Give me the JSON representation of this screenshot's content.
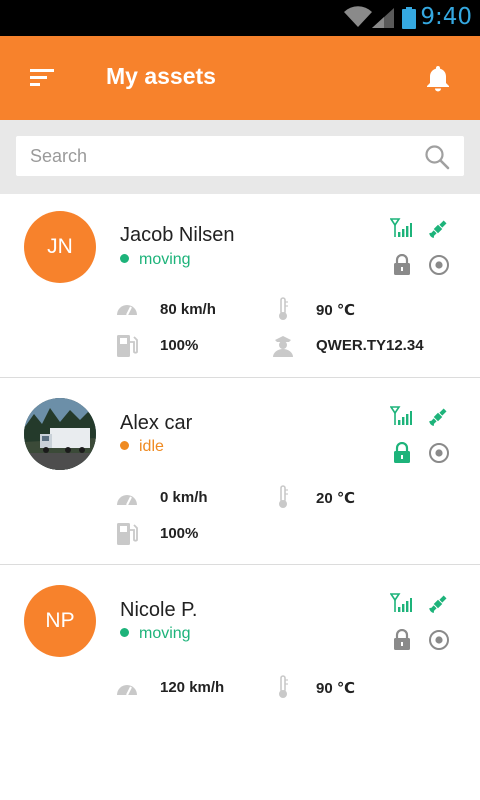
{
  "status_bar": {
    "time": "9:40"
  },
  "app_bar": {
    "title": "My assets"
  },
  "search": {
    "placeholder": "Search"
  },
  "colors": {
    "accent": "#f7822c",
    "moving": "#1db37a",
    "idle": "#ef8a21",
    "signal_green": "#1db37a",
    "status_blue": "#35a8e0"
  },
  "assets": [
    {
      "initials": "JN",
      "name": "Jacob Nilsen",
      "status": "moving",
      "lock": "locked-gray",
      "speed": "80 km/h",
      "temperature": "90 ℃",
      "fuel": "100%",
      "driver": "QWER.TY12.34"
    },
    {
      "initials": "",
      "name": "Alex car",
      "status": "idle",
      "lock": "locked-green",
      "speed": "0 km/h",
      "temperature": "20 ℃",
      "fuel": "100%"
    },
    {
      "initials": "NP",
      "name": "Nicole P.",
      "status": "moving",
      "lock": "locked-gray",
      "speed": "120 km/h",
      "temperature": "90 ℃"
    }
  ]
}
